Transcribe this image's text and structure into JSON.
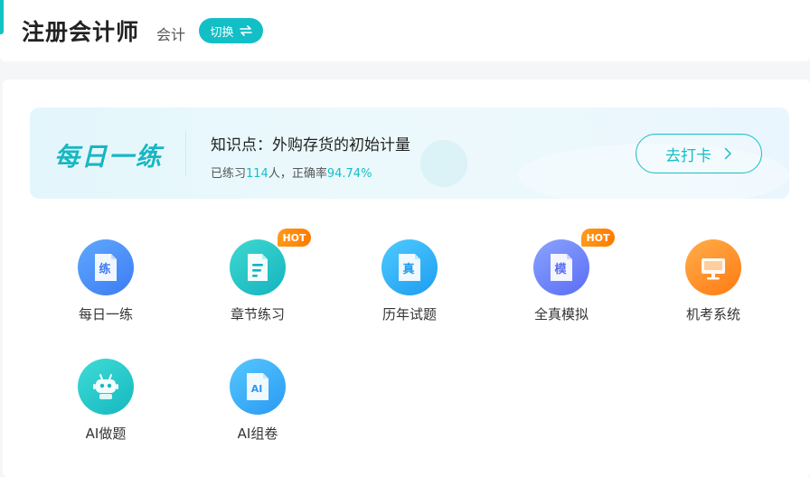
{
  "header": {
    "title": "注册会计师",
    "subject": "会计",
    "switch_label": "切换"
  },
  "banner": {
    "logo_text": "每日一练",
    "topic": "知识点：外购存货的初始计量",
    "stats_prefix": "已练习",
    "stats_count": "114",
    "stats_mid": "人，正确率",
    "stats_rate": "94.74%",
    "checkin_label": "去打卡"
  },
  "features": [
    {
      "label": "每日一练",
      "icon": "practice-doc-icon",
      "glyph": "练",
      "hot": ""
    },
    {
      "label": "章节练习",
      "icon": "chapter-doc-icon",
      "glyph": "",
      "hot": "HOT"
    },
    {
      "label": "历年试题",
      "icon": "past-exam-doc-icon",
      "glyph": "真",
      "hot": ""
    },
    {
      "label": "全真模拟",
      "icon": "mock-exam-doc-icon",
      "glyph": "模",
      "hot": "HOT"
    },
    {
      "label": "机考系统",
      "icon": "computer-monitor-icon",
      "glyph": "",
      "hot": ""
    },
    {
      "label": "AI做题",
      "icon": "robot-icon",
      "glyph": "",
      "hot": ""
    },
    {
      "label": "AI组卷",
      "icon": "ai-doc-icon",
      "glyph": "AI",
      "hot": ""
    }
  ],
  "colors": {
    "accent": "#13bfc6",
    "hot": "#ff8a00"
  }
}
